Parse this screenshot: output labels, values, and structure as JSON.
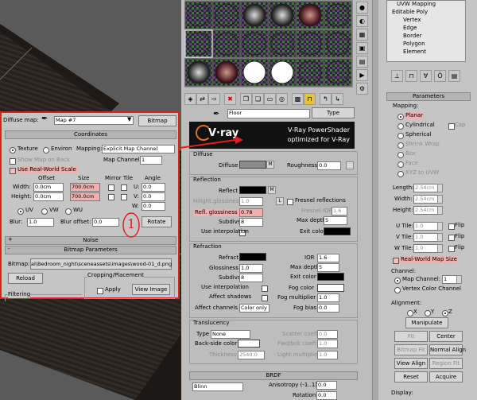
{
  "stack": {
    "items": [
      "UVW Mapping",
      "Editable Poly",
      "Vertex",
      "Edge",
      "Border",
      "Polygon",
      "Element"
    ]
  },
  "params": {
    "title": "Parameters",
    "mapping_label": "Mapping:",
    "options": [
      "Planar",
      "Cylindrical",
      "Spherical",
      "Shrink Wrap",
      "Box",
      "Face",
      "XYZ to UVW"
    ],
    "cap": "Cap",
    "length_label": "Length:",
    "length": "2.54cm",
    "width_label": "Width:",
    "width": "2.54cm",
    "height_label": "Height:",
    "height": "2.54cm",
    "utile_label": "U Tile:",
    "utile": "1.0",
    "vtile_label": "V Tile:",
    "vtile": "1.0",
    "wtile_label": "W Tile:",
    "wtile": "1.0",
    "flip": "Flip",
    "real_world": "Real-World Map Size",
    "channel_label": "Channel:",
    "map_channel_label": "Map Channel:",
    "map_channel": "1",
    "vertex_color": "Vertex Color Channel",
    "alignment_label": "Alignment:",
    "x": "X",
    "y": "Y",
    "z": "Z",
    "manipulate": "Manipulate",
    "fit": "Fit",
    "center": "Center",
    "bitmap_fit": "Bitmap Fit",
    "normal_align": "Normal Align",
    "view_align": "View Align",
    "region_fit": "Region Fit",
    "reset": "Reset",
    "acquire": "Acquire",
    "display_label": "Display:"
  },
  "mat": {
    "name": "Floor",
    "type": "Type",
    "logo": "V·ray",
    "header1": "V-Ray PowerShader",
    "header2": "optimized for V-Ray",
    "diffuse_title": "Diffuse",
    "diffuse": "Diffuse",
    "m": "M",
    "roughness": "Roughness",
    "roughness_val": "0.0",
    "reflection_title": "Reflection",
    "reflect": "Reflect",
    "hilight": "Hilight glossiness",
    "hilight_val": "1.0",
    "l": "L",
    "refl_gloss": "Refl. glossiness",
    "refl_gloss_val": "0.78",
    "subdivs": "Subdivs",
    "subdivs_val": "8",
    "use_interp": "Use interpolation",
    "fresnel": "Fresnel reflections",
    "fresnel_ior": "Fresnel IOR",
    "fresnel_ior_val": "1.6",
    "max_depth": "Max depth",
    "max_depth_val": "5",
    "exit_color": "Exit color",
    "refraction_title": "Refraction",
    "refract": "Refract",
    "ior": "IOR",
    "ior_val": "1.6",
    "glossiness": "Glossiness",
    "glossiness_val": "1.0",
    "r_subdivs_val": "8",
    "r_max_depth_val": "5",
    "affect_shadows": "Affect shadows",
    "affect_channels": "Affect channels",
    "color_only": "Color only",
    "fog_color": "Fog color",
    "fog_mult": "Fog multiplier",
    "fog_mult_val": "1.0",
    "fog_bias": "Fog bias",
    "fog_bias_val": "0.0",
    "translucency_title": "Translucency",
    "type_val": "None",
    "back_side": "Back-side color",
    "thickness": "Thickness",
    "thickness_val": "2540.0",
    "scatter": "Scatter coeff",
    "scatter_val": "0.0",
    "fwd_bck": "Fwd/bck coeff",
    "fwd_bck_val": "1.0",
    "light_mult": "Light multiplier",
    "light_mult_val": "1.0",
    "brdf_title": "BRDF",
    "blinn": "Blinn",
    "anisotropy": "Anisotropy (-1..1)",
    "anisotropy_val": "0.0",
    "rotation": "Rotation",
    "rotation_val": "0.0"
  },
  "diff": {
    "label": "Diffuse map:",
    "map": "Map #7",
    "bitmap": "Bitmap",
    "coordinates": "Coordinates",
    "texture": "Texture",
    "environ": "Environ",
    "mapping": "Mapping:",
    "mapping_val": "Explicit Map Channel",
    "show_map": "Show Map on Back",
    "map_channel": "Map Channel:",
    "map_channel_val": "1",
    "real_world": "Use Real-World Scale",
    "offset": "Offset",
    "size": "Size",
    "mirror_tile": "Mirror Tile",
    "angle": "Angle",
    "width": "Width:",
    "width_off": "0.0cm",
    "width_size": "700.0cm",
    "height": "Height:",
    "height_off": "0.0cm",
    "height_size": "700.0cm",
    "u": "U:",
    "u_val": "0.0",
    "v": "V:",
    "v_val": "0.0",
    "w": "W:",
    "w_val": "0.0",
    "uv": "UV",
    "vw": "VW",
    "wu": "WU",
    "blur": "Blur:",
    "blur_val": "1.0",
    "blur_off": "Blur offset:",
    "blur_off_val": "0.0",
    "rotate": "Rotate",
    "noise": "Noise",
    "bitmap_params": "Bitmap Parameters",
    "bitmap_label": "Bitmap:",
    "bitmap_path": "al\\Bedroom_night\\sceneassets\\images\\wood-01_d.png",
    "reload": "Reload",
    "cropping": "Cropping/Placement",
    "apply": "Apply",
    "view_image": "View Image",
    "filtering": "Filtering",
    "annotation": "1"
  },
  "colors": {
    "highlight": "#e02020",
    "viewport": "#5a5a5a",
    "panel": "#c5c5c5"
  }
}
